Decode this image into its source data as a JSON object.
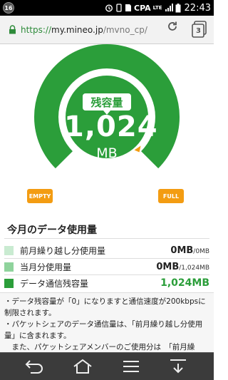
{
  "status_bar": {
    "notification_count": "16",
    "carrier": "CPA",
    "network": "LTE",
    "time": "22:43"
  },
  "browser": {
    "url_scheme": "https://",
    "url_host": "my.mineo.jp",
    "url_path": "/mvno_cp/",
    "tab_count": "3"
  },
  "gauge": {
    "label": "残容量",
    "value": "1,024",
    "unit": "MB",
    "empty_label": "EMPTY",
    "full_label": "FULL",
    "remaining_fraction": 1.0,
    "colors": {
      "ring": "#2b9e3a",
      "track": "#dcdcdc",
      "accent": "#f39c12"
    }
  },
  "usage": {
    "title": "今月のデータ使用量",
    "rows": [
      {
        "label": "前月繰り越し分使用量",
        "value": "0MB",
        "total": "/0MB",
        "color": "#c9ebd1"
      },
      {
        "label": "当月分使用量",
        "value": "0MB",
        "total": "/1,024MB",
        "color": "#8fd39c"
      },
      {
        "label": "データ通信残容量",
        "value": "1,024MB",
        "total": "",
        "color": "#2b9e3a"
      }
    ]
  },
  "notes": [
    "・データ残容量が「0」になりますと通信速度が200kbpsに制限されます。",
    "・パケットシェアのデータ通信量は、「前月繰り越し分使用量」に含まれます。",
    "　また、パケットシェアメンバーのご使用分は　「前月繰"
  ]
}
